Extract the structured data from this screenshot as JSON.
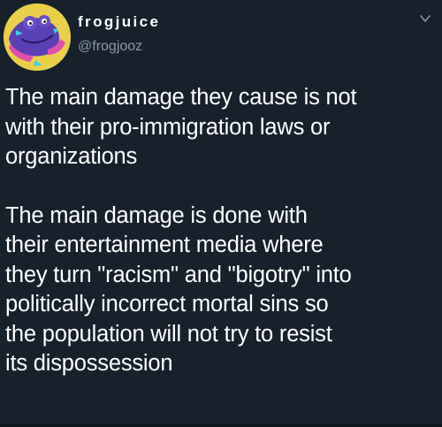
{
  "tweet": {
    "display_name": "frogjuice",
    "handle": "@frogjooz",
    "paragraphs": [
      "The main damage they cause is not\nwith their pro-immigration laws or\norganizations",
      "The main damage is done with\ntheir entertainment media where\nthey turn \"racism\" and \"bigotry\" into\npolitically incorrect mortal sins so\nthe population will not try to resist\nits dispossession"
    ]
  },
  "colors": {
    "background": "#16212c",
    "text": "#ffffff",
    "secondary_text": "#8b98a5",
    "avatar_bg": "#e9cf4a",
    "avatar_frog": "#5b3fb5"
  },
  "icons": {
    "avatar": "frog-avatar-icon",
    "menu": "chevron-down-icon"
  }
}
